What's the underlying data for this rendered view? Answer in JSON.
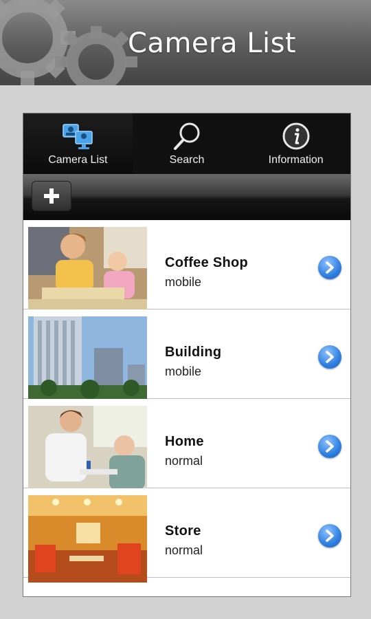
{
  "header": {
    "title": "Camera List"
  },
  "tabs": [
    {
      "label": "Camera List",
      "icon": "camera-list-icon",
      "active": true
    },
    {
      "label": "Search",
      "icon": "search-icon",
      "active": false
    },
    {
      "label": "Information",
      "icon": "info-icon",
      "active": false
    }
  ],
  "toolbar": {
    "add_icon": "plus-icon"
  },
  "cameras": [
    {
      "name": "Coffee Shop",
      "type": "mobile",
      "thumbnail": "reading-with-child-photo"
    },
    {
      "name": "Building",
      "type": "mobile",
      "thumbnail": "office-towers-photo"
    },
    {
      "name": "Home",
      "type": "normal",
      "thumbnail": "caregiver-elderly-photo"
    },
    {
      "name": "Store",
      "type": "normal",
      "thumbnail": "restaurant-interior-photo"
    }
  ],
  "colors": {
    "accent": "#2f7fe0",
    "header": "#5c5c5c",
    "tabbar": "#111111"
  }
}
